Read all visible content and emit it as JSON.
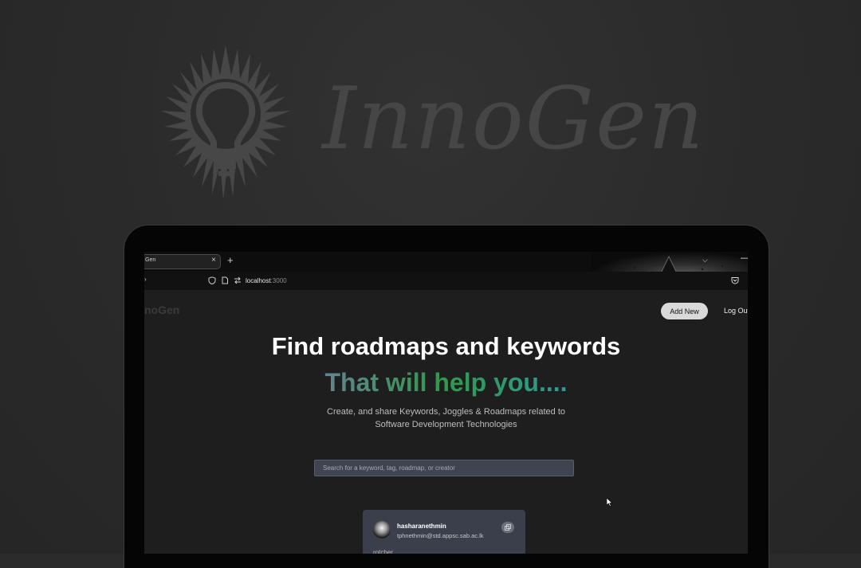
{
  "brand": {
    "name": "InnoGen"
  },
  "browser": {
    "tab_title": "Gen",
    "tab_close": "×",
    "new_tab": "+",
    "tabs_dropdown": "⌵",
    "minimize": "—",
    "url_host": "localhost",
    "url_port": ":3000",
    "nav_forward": "›"
  },
  "header": {
    "logo": "noGen",
    "add_new": "Add New",
    "log_out": "Log Out"
  },
  "hero": {
    "title": "Find roadmaps and keywords",
    "subtitle": "That will help you....",
    "description": "Create, and share Keywords, Joggles & Roadmaps related to Software Development Technologies"
  },
  "search": {
    "placeholder": "Search for a keyword, tag, roadmap, or creator",
    "value": ""
  },
  "card": {
    "username": "hasharanethmin",
    "email": "tphnethmin@std.appsc.sab.ac.lk",
    "body": "rotcher"
  },
  "colors": {
    "background": "#2b2b2b",
    "page": "#1e1e1e",
    "card": "#3a3f4b",
    "search": "#3f4450",
    "gradient": [
      "#8f5ae8",
      "#6e7ea2",
      "#2f9a4a",
      "#2e9a9a",
      "#3b82f6"
    ]
  }
}
